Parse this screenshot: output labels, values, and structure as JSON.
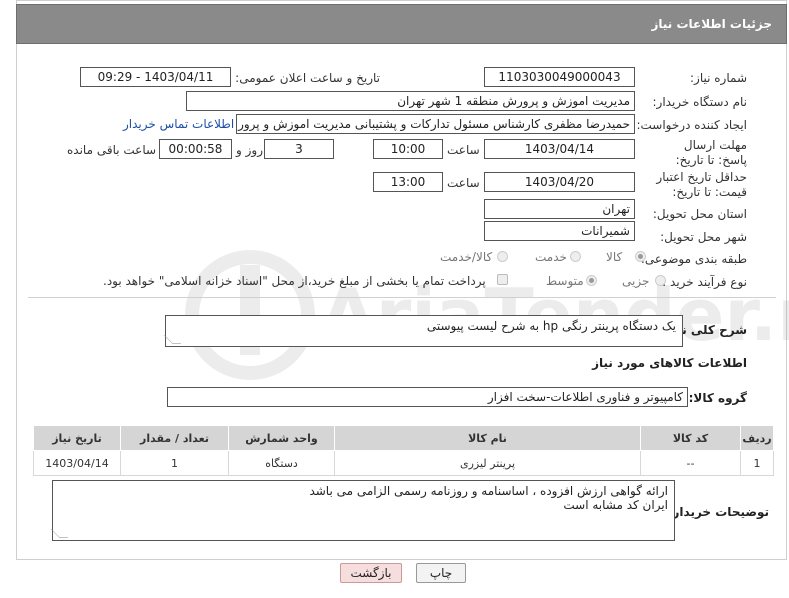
{
  "header": {
    "title": "جزئیات اطلاعات نیاز"
  },
  "fields": {
    "need_number_label": "شماره نیاز:",
    "need_number": "1103030049000043",
    "announce_label": "تاریخ و ساعت اعلان عمومی:",
    "announce_value": "1403/04/11 - 09:29",
    "buyer_label": "نام دستگاه خریدار:",
    "buyer": "مدیریت اموزش و پرورش منطقه 1 شهر تهران",
    "creator_label": "ایجاد کننده درخواست:",
    "creator": "حمیدرضا مظفری کارشناس مسئول تدارکات و پشتیبانی مدیریت اموزش و پرورش",
    "buyer_contact_link": "اطلاعات تماس خریدار",
    "reply_label": "مهلت ارسال پاسخ: تا تاریخ:",
    "reply_date": "1403/04/14",
    "time_label": "ساعت",
    "reply_time": "10:00",
    "days": "3",
    "day_label": "روز و",
    "remaining": "00:00:58",
    "remaining_label": "ساعت باقی مانده",
    "validity_label": "حداقل تاریخ اعتبار قیمت: تا تاریخ:",
    "validity_date": "1403/04/20",
    "validity_time": "13:00",
    "province_label": "استان محل تحویل:",
    "province": "تهران",
    "city_label": "شهر محل تحویل:",
    "city": "شمیرانات",
    "category_label": "طبقه بندی موضوعی:",
    "category_options": [
      "کالا",
      "خدمت",
      "کالا/خدمت"
    ],
    "process_label": "نوع فرآیند خرید :",
    "process_options": [
      "جزیی",
      "متوسط"
    ],
    "payment_note": "پرداخت تمام یا بخشی از مبلغ خرید،از محل \"اسناد خزانه اسلامی\" خواهد بود."
  },
  "description": {
    "label": "شرح کلی نیاز:",
    "text": "یک دستگاه پرینتر رنگی hp به شرح لیست پیوستی"
  },
  "goods": {
    "section_title": "اطلاعات کالاهای مورد نیاز",
    "group_label": "گروه کالا:",
    "group_value": "کامپیوتر و فناوری اطلاعات-سخت افزار",
    "columns": [
      "ردیف",
      "کد کالا",
      "نام کالا",
      "واحد شمارش",
      "تعداد / مقدار",
      "تاریخ نیاز"
    ],
    "rows": [
      {
        "row": "1",
        "code": "--",
        "name": "پرینتر لیزری",
        "unit": "دستگاه",
        "qty": "1",
        "date": "1403/04/14"
      }
    ]
  },
  "buyer_notes": {
    "label": "توضیحات خریدار:",
    "line1": "ارائه گواهی ارزش افزوده ، اساسنامه و روزنامه رسمی الزامی می باشد",
    "line2": "ایران کد مشابه است"
  },
  "buttons": {
    "print": "چاپ",
    "back": "بازگشت"
  },
  "watermark": {
    "text": "AriaTender.neT"
  },
  "colors": {
    "header_bg": "#8a8a8a",
    "link": "#1d4fa8",
    "back_button_bg": "#f7dede"
  }
}
